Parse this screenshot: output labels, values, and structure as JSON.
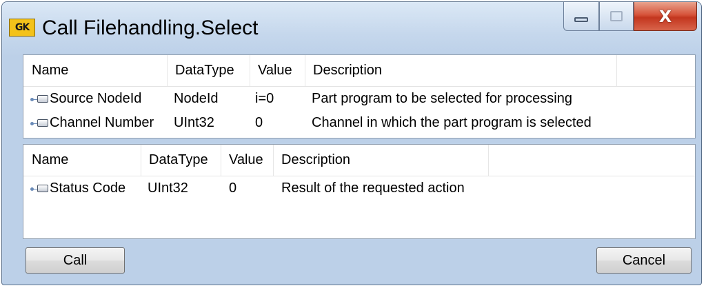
{
  "window": {
    "title": "Call Filehandling.Select",
    "app_icon_text": "GK",
    "close_glyph": "X"
  },
  "input_args": {
    "columns": [
      "Name",
      "DataType",
      "Value",
      "Description"
    ],
    "rows": [
      {
        "name": "Source NodeId",
        "datatype": "NodeId",
        "value": "i=0",
        "description": "Part program to be selected for processing"
      },
      {
        "name": "Channel Number",
        "datatype": "UInt32",
        "value": "0",
        "description": "Channel in which the part program is selected"
      }
    ]
  },
  "output_args": {
    "columns": [
      "Name",
      "DataType",
      "Value",
      "Description"
    ],
    "rows": [
      {
        "name": "Status Code",
        "datatype": "UInt32",
        "value": "0",
        "description": "Result of the requested action"
      }
    ]
  },
  "buttons": {
    "call_label": "Call",
    "cancel_label": "Cancel"
  }
}
